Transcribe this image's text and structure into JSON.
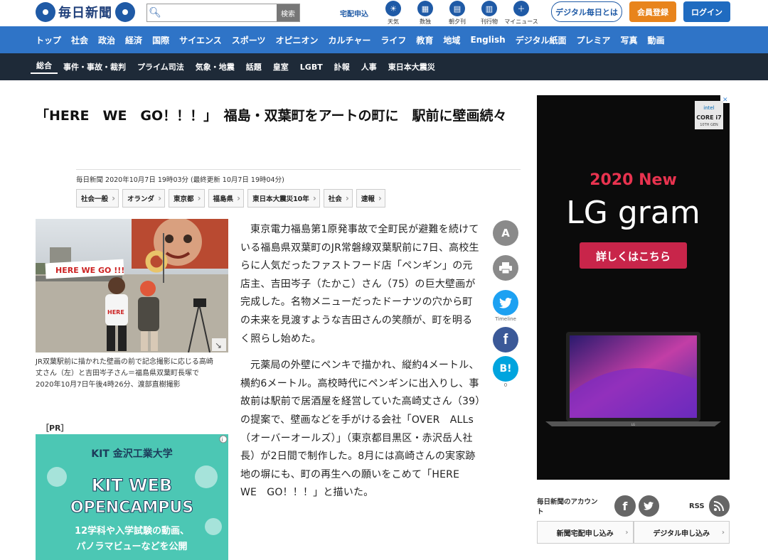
{
  "header": {
    "logo_text": "毎日新聞",
    "search_placeholder": "",
    "search_button": "検索",
    "delivery_link": "宅配申込",
    "quick_links": [
      {
        "label": "天気",
        "icon": "weather-icon"
      },
      {
        "label": "数独",
        "icon": "sudoku-icon"
      },
      {
        "label": "朝夕刊",
        "icon": "newspaper-icon"
      },
      {
        "label": "刊行物",
        "icon": "book-icon"
      },
      {
        "label": "マイニュース",
        "icon": "mynews-icon"
      }
    ],
    "digital_button": "デジタル毎日とは",
    "member_button": "会員登録",
    "login_button": "ログイン"
  },
  "nav_primary": [
    "トップ",
    "社会",
    "政治",
    "経済",
    "国際",
    "サイエンス",
    "スポーツ",
    "オピニオン",
    "カルチャー",
    "ライフ",
    "教育",
    "地域",
    "English",
    "デジタル紙面",
    "プレミア",
    "写真",
    "動画"
  ],
  "nav_secondary": [
    "総合",
    "事件・事故・裁判",
    "プライム司法",
    "気象・地震",
    "話題",
    "皇室",
    "LGBT",
    "訃報",
    "人事",
    "東日本大震災"
  ],
  "article": {
    "title": "「HERE　WE　GO！！！」　福島・双葉町をアートの町に　駅前に壁画続々",
    "dateline": "毎日新聞 2020年10月7日 19時03分 (最終更新 10月7日 19時04分)",
    "tags": [
      "社会一般",
      "オランダ",
      "東京都",
      "福島県",
      "東日本大震災10年",
      "社会",
      "速報"
    ],
    "photo_sign": "HERE WE GO !!!",
    "photo_shirt": "HERE",
    "caption": "JR双葉駅前に描かれた壁画の前で記念撮影に応じる高崎丈さん（左）と吉田岑子さん＝福島県双葉町長塚で2020年10月7日午後4時26分、渡部直樹撮影",
    "paragraphs": [
      "東京電力福島第1原発事故で全町民が避難を続けている福島県双葉町のJR常磐線双葉駅前に7日、高校生らに人気だったファストフード店「ペンギン」の元店主、吉田岑子（たかこ）さん（75）の巨大壁画が完成した。名物メニューだったドーナツの穴から町の未来を見渡すような吉田さんの笑顔が、町を明るく照らし始めた。",
      "元薬局の外壁にペンキで描かれ、縦約4メートル、横約6メートル。高校時代にペンギンに出入りし、事故前は駅前で居酒屋を経営していた高崎丈さん（39）の提案で、壁画などを手がける会社「OVER　ALLs（オーバーオールズ）」（東京都目黒区・赤沢岳人社長）が2日間で制作した。8月には高崎さんの実家跡地の塀にも、町の再生への願いをこめて「HERE　WE　GO！！！」と描いた。"
    ]
  },
  "share": {
    "font_size": "A",
    "print": "print",
    "twitter_label": "Timeline",
    "facebook": "f",
    "hatena": "B!",
    "hatena_count": "0"
  },
  "pr": {
    "label": "［PR］",
    "brand": "KIT 金沢工業大学",
    "headline1": "KIT WEB",
    "headline2": "OPENCAMPUS",
    "sub1": "12学科や入学試験の動画、",
    "sub2": "パノラマビューなどを公開"
  },
  "side_ad": {
    "badge_top": "intel",
    "badge_main": "CORE i7",
    "badge_sub": "10TH GEN",
    "line1": "2020 New",
    "line2": "LG gram",
    "cta": "詳しくはこちら",
    "laptop_brand": "LG"
  },
  "sidebar": {
    "accounts_label": "毎日新聞のアカウント",
    "rss_label": "RSS",
    "subscribe_button": "新聞宅配申し込み",
    "digital_subscribe_button": "デジタル申し込み"
  }
}
